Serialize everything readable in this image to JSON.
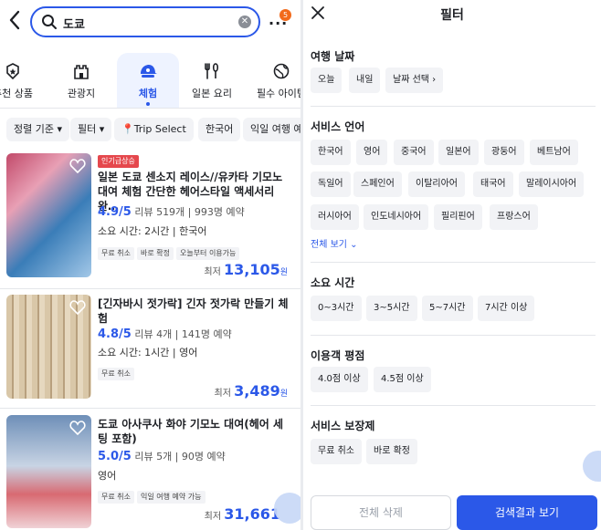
{
  "search": {
    "query": "도쿄",
    "badge": "5"
  },
  "categories": [
    {
      "label": "추천 상품",
      "icon": "star-badge-icon"
    },
    {
      "label": "관광지",
      "icon": "castle-icon"
    },
    {
      "label": "체험",
      "icon": "cap-icon"
    },
    {
      "label": "일본 요리",
      "icon": "utensils-icon"
    },
    {
      "label": "필수 아이템",
      "icon": "globe-icon"
    }
  ],
  "filter_chips": [
    "정렬 기준",
    "필터",
    "Trip Select",
    "한국어",
    "익일 여행 예"
  ],
  "products": [
    {
      "badge": "인기급상승",
      "title": "일본 도쿄 센소지 레이스//유카타 기모노 대여 체험 간단한 헤어스타일 액세서리 완…",
      "rating": "4.9",
      "rating_max": "/5",
      "reviews": "리뷰 519개",
      "bookings": "993명 예약",
      "duration": "소요 시간: 2시간",
      "language": "한국어",
      "tags": [
        "무료 취소",
        "바로 확정",
        "오늘부터 이용가능"
      ],
      "price_prefix": "최저",
      "price": "13,105",
      "currency": "원"
    },
    {
      "title": "[긴자바시 젓가락] 긴자 젓가락 만들기 체험",
      "rating": "4.8",
      "rating_max": "/5",
      "reviews": "리뷰 4개",
      "bookings": "141명 예약",
      "duration": "소요 시간: 1시간",
      "language": "영어",
      "tags": [
        "무료 취소"
      ],
      "price_prefix": "최저",
      "price": "3,489",
      "currency": "원"
    },
    {
      "title": "도쿄 아사쿠사 화야 기모노 대여(헤어 세팅 포함)",
      "rating": "5.0",
      "rating_max": "/5",
      "reviews": "리뷰 5개",
      "bookings": "90명 예약",
      "language": "영어",
      "tags": [
        "무료 취소",
        "익일 여행 예약 가능"
      ],
      "price_prefix": "최저",
      "price": "31,661",
      "currency": ""
    }
  ],
  "filter_panel": {
    "title": "필터",
    "travel_date": {
      "label": "여행 날짜",
      "options": [
        "오늘",
        "내일",
        "날짜 선택"
      ]
    },
    "language": {
      "label": "서비스 언어",
      "options": [
        "한국어",
        "영어",
        "중국어",
        "일본어",
        "광둥어",
        "베트남어",
        "독일어",
        "스페인어",
        "이탈리아어",
        "태국어",
        "말레이시아어",
        "러시아어",
        "인도네시아어",
        "필리핀어",
        "프랑스어"
      ],
      "view_all": "전체 보기"
    },
    "duration": {
      "label": "소요 시간",
      "options": [
        "0~3시간",
        "3~5시간",
        "5~7시간",
        "7시간 이상"
      ]
    },
    "rating": {
      "label": "이용객 평점",
      "options": [
        "4.0점 이상",
        "4.5점 이상"
      ]
    },
    "guarantee": {
      "label": "서비스 보장제",
      "options": [
        "무료 취소",
        "바로 확정"
      ]
    },
    "reset": "전체 삭제",
    "apply": "검색결과 보기"
  },
  "colors": {
    "accent": "#2b58e8",
    "hot": "#e5484d",
    "badge": "#f26a1b"
  }
}
